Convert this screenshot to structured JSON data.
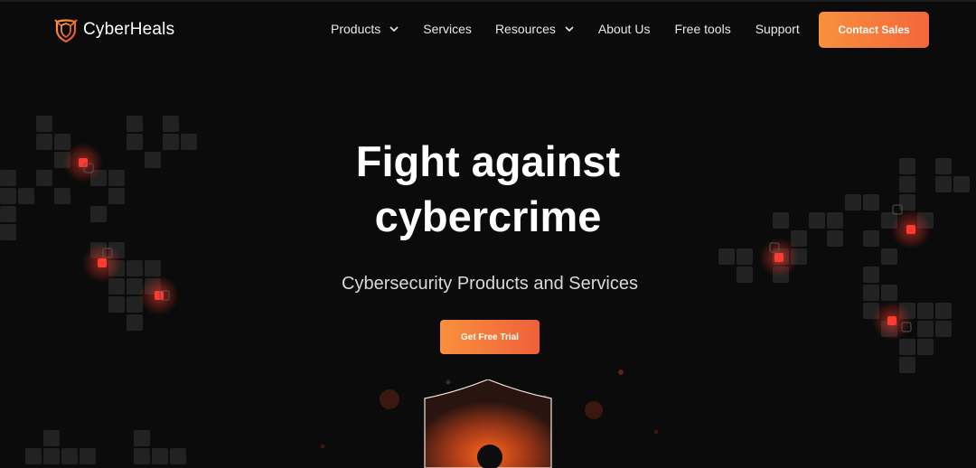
{
  "brand": {
    "name_part1": "Cyber",
    "name_part2": "Heals",
    "logo_icon": "shield-logo-icon"
  },
  "nav": {
    "items": [
      {
        "label": "Products",
        "has_dropdown": true
      },
      {
        "label": "Services",
        "has_dropdown": false
      },
      {
        "label": "Resources",
        "has_dropdown": true
      },
      {
        "label": "About Us",
        "has_dropdown": false
      },
      {
        "label": "Free tools",
        "has_dropdown": false
      },
      {
        "label": "Support",
        "has_dropdown": false
      }
    ],
    "cta_label": "Contact Sales"
  },
  "hero": {
    "title_line1": "Fight against",
    "title_line2": "cybercrime",
    "subtitle": "Cybersecurity Products and Services",
    "cta_label": "Get Free Trial"
  },
  "colors": {
    "background": "#0b0b0b",
    "accent_start": "#f8903c",
    "accent_end": "#f4673a",
    "grid_cell": "#2a2a2a",
    "alert_red": "#ff3b2f"
  }
}
